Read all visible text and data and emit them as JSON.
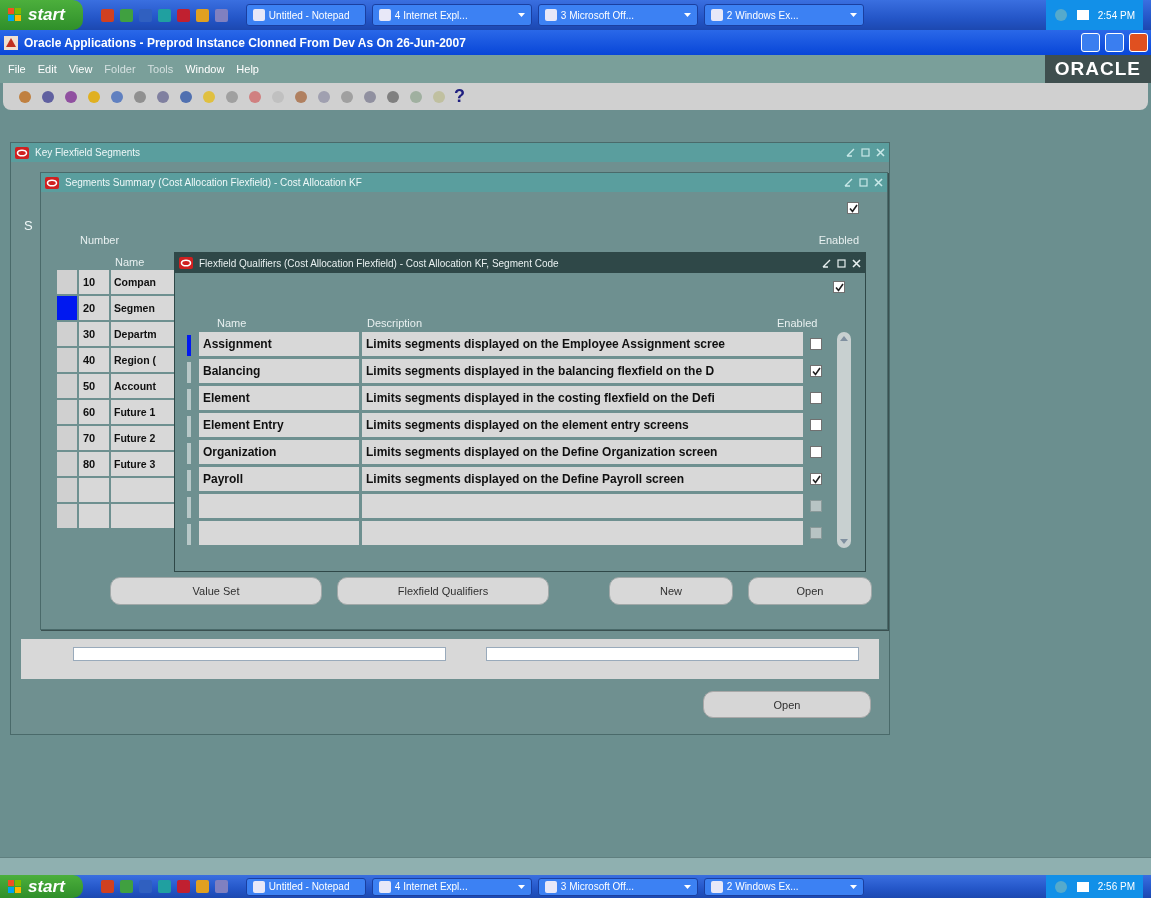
{
  "taskbar_top": {
    "start": "start",
    "tasks": [
      {
        "label": "Untitled - Notepad",
        "grouped": false
      },
      {
        "label": "4 Internet Expl...",
        "grouped": true
      },
      {
        "label": "3 Microsoft Off...",
        "grouped": true
      },
      {
        "label": "2 Windows Ex...",
        "grouped": true
      }
    ],
    "clock": "2:54 PM"
  },
  "app_window": {
    "title": "Oracle Applications - Preprod Instance Clonned From Dev As On 26-Jun-2007",
    "menu": [
      {
        "label": "File",
        "disabled": false
      },
      {
        "label": "Edit",
        "disabled": false
      },
      {
        "label": "View",
        "disabled": false
      },
      {
        "label": "Folder",
        "disabled": true
      },
      {
        "label": "Tools",
        "disabled": true
      },
      {
        "label": "Window",
        "disabled": false
      },
      {
        "label": "Help",
        "disabled": false
      }
    ],
    "logo": "ORACLE",
    "toolbar_help": "?"
  },
  "key_window": {
    "title": "Key Flexfield Segments",
    "section_label": "S",
    "open_button": "Open"
  },
  "summary_window": {
    "title": "Segments Summary (Cost Allocation Flexfield) - Cost Allocation KF",
    "top_check": true,
    "columns": {
      "number": "Number",
      "name": "Name",
      "enabled": "Enabled"
    },
    "rows": [
      {
        "kind": "data",
        "number": "10",
        "name": "Compan",
        "selected": false
      },
      {
        "kind": "data",
        "number": "20",
        "name": "Segmen",
        "selected": true
      },
      {
        "kind": "data",
        "number": "30",
        "name": "Departm",
        "selected": false
      },
      {
        "kind": "data",
        "number": "40",
        "name": "Region (",
        "selected": false
      },
      {
        "kind": "data",
        "number": "50",
        "name": "Account",
        "selected": false
      },
      {
        "kind": "data",
        "number": "60",
        "name": "Future 1",
        "selected": false
      },
      {
        "kind": "data",
        "number": "70",
        "name": "Future 2",
        "selected": false
      },
      {
        "kind": "data",
        "number": "80",
        "name": "Future 3",
        "selected": false
      },
      {
        "kind": "empty",
        "selected": false
      },
      {
        "kind": "empty",
        "selected": false
      }
    ],
    "buttons": [
      "Value Set",
      "Flexfield Qualifiers",
      "New",
      "Open"
    ]
  },
  "qualifiers_window": {
    "title": "Flexfield Qualifiers (Cost Allocation Flexfield) - Cost Allocation KF, Segment Code",
    "top_check": true,
    "columns": {
      "name": "Name",
      "description": "Description",
      "enabled": "Enabled"
    },
    "rows": [
      {
        "kind": "data",
        "name": "Assignment",
        "description": "Limits segments displayed on the Employee Assignment scree",
        "enabled": false,
        "selected": true
      },
      {
        "kind": "data",
        "name": "Balancing",
        "description": "Limits segments displayed in the balancing flexfield on the D",
        "enabled": true,
        "selected": false
      },
      {
        "kind": "data",
        "name": "Element",
        "description": "Limits segments displayed in the costing flexfield on the Defi",
        "enabled": false,
        "selected": false
      },
      {
        "kind": "data",
        "name": "Element Entry",
        "description": "Limits segments displayed on the element entry screens",
        "enabled": false,
        "selected": false
      },
      {
        "kind": "data",
        "name": "Organization",
        "description": "Limits segments displayed on the Define Organization screen",
        "enabled": false,
        "selected": false
      },
      {
        "kind": "data",
        "name": "Payroll",
        "description": "Limits segments displayed on the Define Payroll screen",
        "enabled": true,
        "selected": false
      },
      {
        "kind": "empty",
        "enabled": false,
        "selected": false
      },
      {
        "kind": "empty",
        "enabled": false,
        "selected": false
      }
    ]
  },
  "taskbar_bottom": {
    "start": "start",
    "tasks": [
      {
        "label": "Untitled - Notepad",
        "grouped": false
      },
      {
        "label": "4 Internet Expl...",
        "grouped": true
      },
      {
        "label": "3 Microsoft Off...",
        "grouped": true
      },
      {
        "label": "2 Windows Ex...",
        "grouped": true
      }
    ],
    "clock": "2:56 PM"
  }
}
